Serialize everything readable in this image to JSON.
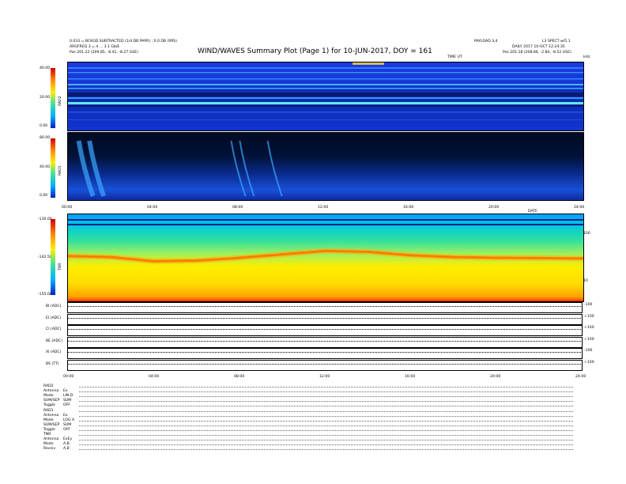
{
  "header": {
    "title": "WIND/WAVES Summary Plot (Page 1) for 10-JUN-2017, DOY = 161",
    "left_line1": "0.033 = BCKGD SUBTRACTED (1/4 DB PAPR) ; 0.0 DB (RPS)",
    "left_line2": "ARGFREQ 3 = 4 ... 3.1 Gb/E",
    "left_line3": "Pos   201.22 (209.85, -8.41, -8.27 GSE)",
    "center_right": "PAYLOAD 3,4",
    "right_line1": "L3 SPECT w/5.1",
    "right_line2": "DAILY 2017 10-OCT 12:24:35",
    "right_line3": "Pos   201.18 (208.84, -2.84, -8.52 GSE)",
    "time_label": "TIME UT",
    "freq_label": "kHz"
  },
  "panels": {
    "rad2": {
      "name": "RAD2",
      "ticks": [
        "40.00",
        "20.00",
        "0.00"
      ]
    },
    "rad1": {
      "name": "RAD1",
      "ticks": [
        "80.00",
        "40.00",
        "0.00"
      ]
    },
    "tnr": {
      "name": "TNR",
      "ticks": [
        "-130.00",
        "-142.50",
        "-155.00"
      ],
      "right_ticks": [
        "100",
        "10"
      ]
    }
  },
  "time_axis": {
    "top": [
      "00:00",
      "04:00",
      "08:00",
      "12:00",
      "16:00",
      "20:00",
      "24:00"
    ],
    "bottom": [
      "00:00",
      "04:00",
      "08:00",
      "12:00",
      "16:00",
      "20:00",
      "24:00"
    ],
    "date_label": "DATE"
  },
  "tracks": [
    {
      "label": "BI (ADC)",
      "scale": "-100"
    },
    {
      "label": "EI (ADC)",
      "scale": "+100"
    },
    {
      "label": "CI (ADC)",
      "scale": "+100"
    },
    {
      "label": "BE (ADC)",
      "scale": "+100"
    },
    {
      "label": "XI (ADC)",
      "scale": "-100"
    },
    {
      "label": "BS (TT)",
      "scale": "+100"
    }
  ],
  "housekeeping": [
    {
      "label": "RAD2",
      "value": ""
    },
    {
      "label": "Antenna",
      "value": "Ex"
    },
    {
      "label": "Mode",
      "value": "LIN D"
    },
    {
      "label": "SUM/SEP",
      "value": "SUM"
    },
    {
      "label": "Toggle",
      "value": "OFF"
    },
    {
      "label": "RAD1",
      "value": ""
    },
    {
      "label": "Antenna",
      "value": "Ex"
    },
    {
      "label": "Mode",
      "value": "LOG A"
    },
    {
      "label": "SUM/SEP",
      "value": "SUM"
    },
    {
      "label": "Toggle",
      "value": "OFF"
    },
    {
      "label": "TNR",
      "value": ""
    },
    {
      "label": "Antenna",
      "value": "ExEy"
    },
    {
      "label": "Mode",
      "value": "A,B"
    },
    {
      "label": "Receiv",
      "value": "A,B"
    }
  ],
  "colors": {
    "rad_background": "#1030c8",
    "rad1_dark": "#000a30",
    "tnr_low": "#ffee00",
    "tnr_mid": "#00c8d0",
    "tnr_band": "#ff3a00"
  },
  "chart_data": {
    "type": "heatmap",
    "title": "WIND/WAVES Summary Plot (Page 1) for 10-JUN-2017, DOY = 161",
    "x_unit": "hours UT",
    "xlim": [
      0,
      24
    ],
    "rad2": {
      "ylim": [
        0,
        40
      ],
      "banded_intensity": "mostly background, bright lines near 5, 22-25, 32-36 (y units)"
    },
    "rad1": {
      "ylim": [
        0,
        80
      ],
      "bursts_hours": [
        0.5,
        1.0,
        7.6,
        8.0,
        9.3
      ]
    },
    "tnr": {
      "ylim": [
        -155,
        -130
      ],
      "band_center": [
        {
          "x": 0,
          "y": -142.0
        },
        {
          "x": 2,
          "y": -142.3
        },
        {
          "x": 4,
          "y": -143.5
        },
        {
          "x": 6,
          "y": -143.3
        },
        {
          "x": 7.6,
          "y": -142.7
        },
        {
          "x": 10,
          "y": -141.5
        },
        {
          "x": 12,
          "y": -140.5
        },
        {
          "x": 14,
          "y": -140.8
        },
        {
          "x": 16,
          "y": -141.8
        },
        {
          "x": 18,
          "y": -142.3
        },
        {
          "x": 20,
          "y": -142.5
        },
        {
          "x": 22,
          "y": -142.6
        },
        {
          "x": 24,
          "y": -142.7
        }
      ]
    }
  }
}
